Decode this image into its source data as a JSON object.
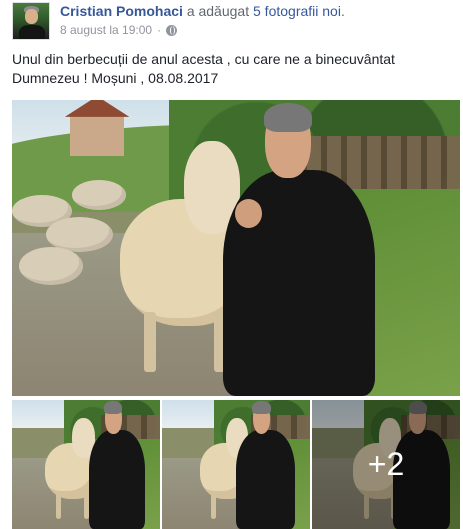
{
  "post": {
    "author": "Cristian Pomohaci",
    "action_text": "a adăugat",
    "photos_link": "5 fotografii noi",
    "action_suffix": ".",
    "timestamp": "8 august la 19:00",
    "separator": "·",
    "privacy_icon": "globe-icon",
    "text": "Unul din berbecuții de anul acesta , cu care ne a binecuvântat Dumnezeu ! Moșuni , 08.08.2017"
  },
  "photos": {
    "more_count_label": "+2"
  },
  "colors": {
    "link": "#365899",
    "meta": "#90949c",
    "text": "#1d2129"
  }
}
